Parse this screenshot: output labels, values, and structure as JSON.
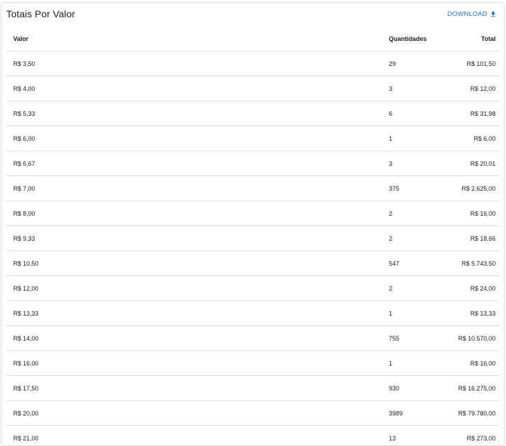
{
  "card": {
    "title": "Totais Por Valor",
    "download_label": "DOWNLOAD",
    "download_icon": "download-icon",
    "accent_color": "#1976d2"
  },
  "table": {
    "headers": {
      "valor": "Valor",
      "quantidades": "Quantidades",
      "total": "Total"
    },
    "rows": [
      {
        "valor": "R$ 3,50",
        "quantidade": "29",
        "total": "R$ 101,50"
      },
      {
        "valor": "R$ 4,00",
        "quantidade": "3",
        "total": "R$ 12,00"
      },
      {
        "valor": "R$ 5,33",
        "quantidade": "6",
        "total": "R$ 31,98"
      },
      {
        "valor": "R$ 6,00",
        "quantidade": "1",
        "total": "R$ 6,00"
      },
      {
        "valor": "R$ 6,67",
        "quantidade": "3",
        "total": "R$ 20,01"
      },
      {
        "valor": "R$ 7,00",
        "quantidade": "375",
        "total": "R$ 2.625,00"
      },
      {
        "valor": "R$ 8,00",
        "quantidade": "2",
        "total": "R$ 16,00"
      },
      {
        "valor": "R$ 9,33",
        "quantidade": "2",
        "total": "R$ 18,66"
      },
      {
        "valor": "R$ 10,50",
        "quantidade": "547",
        "total": "R$ 5.743,50"
      },
      {
        "valor": "R$ 12,00",
        "quantidade": "2",
        "total": "R$ 24,00"
      },
      {
        "valor": "R$ 13,33",
        "quantidade": "1",
        "total": "R$ 13,33"
      },
      {
        "valor": "R$ 14,00",
        "quantidade": "755",
        "total": "R$ 10.570,00"
      },
      {
        "valor": "R$ 16,00",
        "quantidade": "1",
        "total": "R$ 16,00"
      },
      {
        "valor": "R$ 17,50",
        "quantidade": "930",
        "total": "R$ 16.275,00"
      },
      {
        "valor": "R$ 20,00",
        "quantidade": "3989",
        "total": "R$ 79.780,00"
      },
      {
        "valor": "R$ 21,00",
        "quantidade": "13",
        "total": "R$ 273,00"
      }
    ]
  }
}
